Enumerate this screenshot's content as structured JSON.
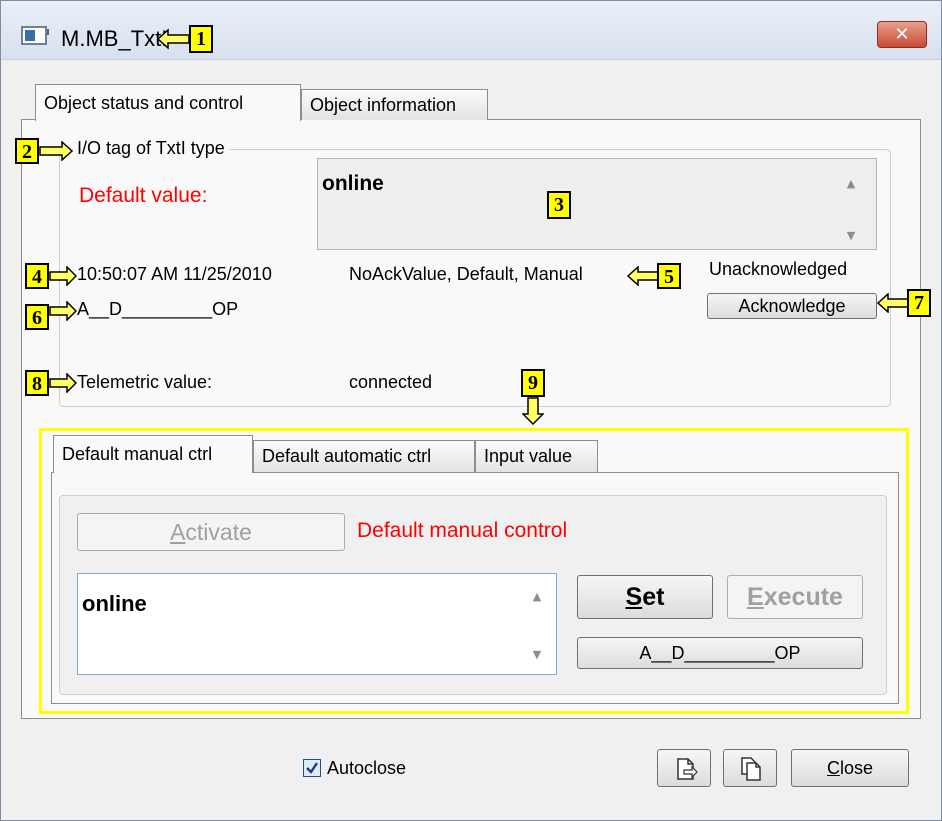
{
  "window": {
    "title": "M.MB_TxtI",
    "close_glyph": "✕"
  },
  "callouts": [
    "1",
    "2",
    "3",
    "4",
    "5",
    "6",
    "7",
    "8",
    "9"
  ],
  "tabs": {
    "status": "Object status and control",
    "info": "Object information"
  },
  "group": {
    "caption": "I/O tag of TxtI type",
    "default_label": "Default value:",
    "value_text": "online",
    "timestamp": "10:50:07 AM 11/25/2010",
    "flags": "NoAckValue, Default, Manual",
    "ack_state": "Unacknowledged",
    "acknowledge_button": "Acknowledge",
    "attributes": "A__D_________OP",
    "telemetric_label": "Telemetric value:",
    "telemetric_value": "connected"
  },
  "subtabs": {
    "manual": "Default manual ctrl",
    "automatic": "Default automatic ctrl",
    "input": "Input value"
  },
  "control": {
    "activate_button": "Activate",
    "activate_mnemonic": "A",
    "activate_rest": "ctivate",
    "section_label": "Default manual control",
    "input_value": "online",
    "set_mnemonic": "S",
    "set_rest": "et",
    "execute_mnemonic": "E",
    "execute_rest": "xecute",
    "attributes_button": "A__D_________OP"
  },
  "footer": {
    "autoclose_label": "Autoclose",
    "autoclose_checked": true,
    "close_mnemonic": "C",
    "close_rest": "lose"
  },
  "icons": [
    "app-icon",
    "copy-icon",
    "paste-icon",
    "check-icon",
    "scroll-up-icon",
    "scroll-down-icon"
  ],
  "colors": {
    "highlight": "#ffff00",
    "alert_text": "#ff0000"
  }
}
